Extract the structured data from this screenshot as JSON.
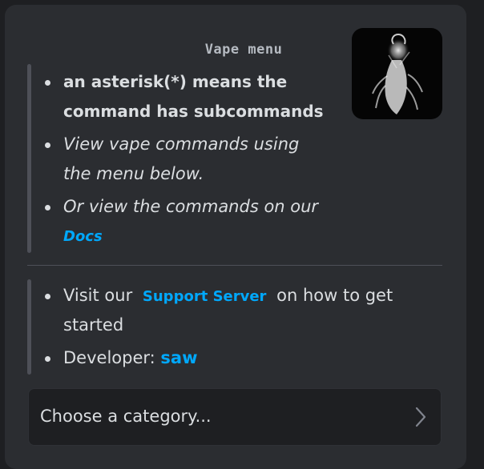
{
  "embed": {
    "title": "Vape menu",
    "intro_bullets": [
      "an asterisk(*) means the",
      "command has subcommands",
      "View vape commands using",
      "the menu below.",
      "Or view the commands on our",
      "Docs"
    ],
    "support": {
      "prefix": "Visit our",
      "link": "Support Server",
      "suffix": "on how to get",
      "line2": "started"
    },
    "developer": {
      "label": "Developer:",
      "name": "saw"
    }
  },
  "select": {
    "placeholder": "Choose a category..."
  },
  "colors": {
    "background": "#2b2d31",
    "link": "#00a8fc",
    "text": "#dbdee1",
    "muted": "#b5bac1"
  },
  "icons": {
    "select_arrow": "chevron-right-icon"
  }
}
